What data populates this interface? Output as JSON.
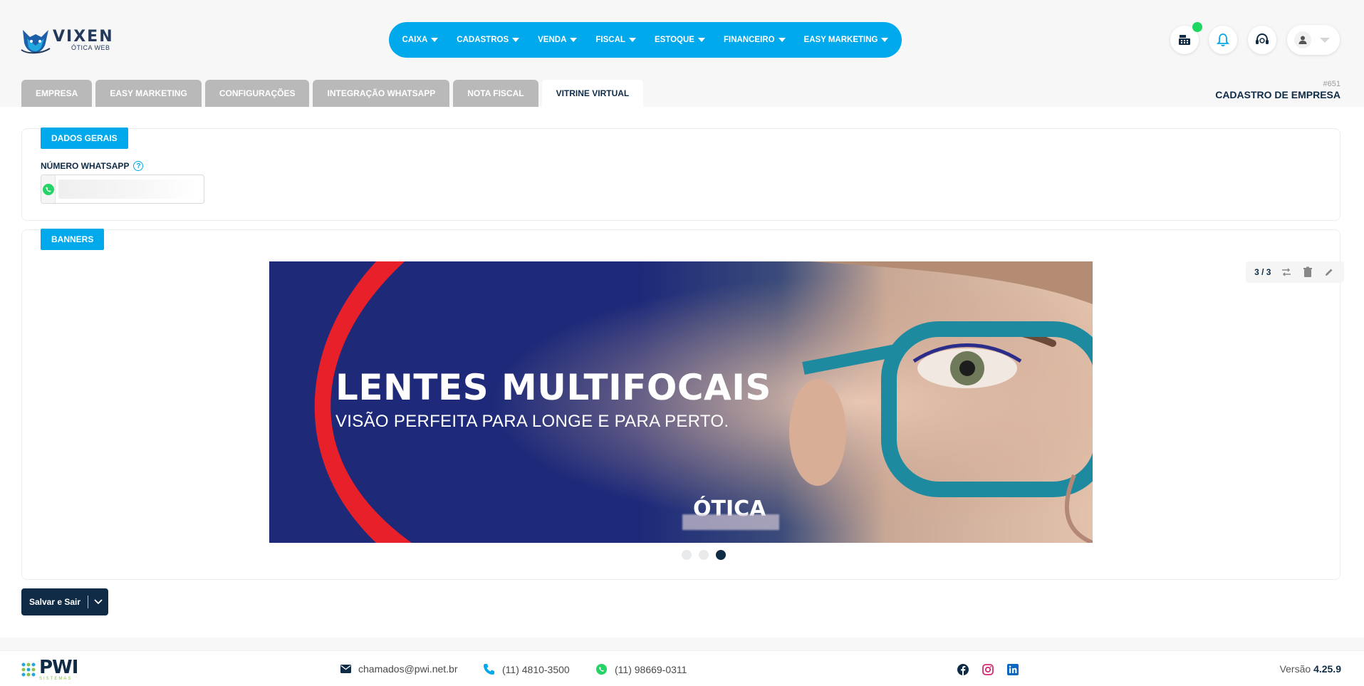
{
  "header": {
    "logo_title": "VIXEN",
    "logo_subtitle": "ÓTICA WEB",
    "nav": [
      {
        "label": "CAIXA"
      },
      {
        "label": "CADASTROS"
      },
      {
        "label": "VENDA"
      },
      {
        "label": "FISCAL"
      },
      {
        "label": "ESTOQUE"
      },
      {
        "label": "FINANCEIRO"
      },
      {
        "label": "EASY MARKETING"
      }
    ],
    "icons": [
      "cash-register-icon",
      "bell-icon",
      "headset-icon",
      "user-icon"
    ]
  },
  "tabs": [
    {
      "label": "EMPRESA",
      "active": false
    },
    {
      "label": "EASY MARKETING",
      "active": false
    },
    {
      "label": "CONFIGURAÇÕES",
      "active": false
    },
    {
      "label": "INTEGRAÇÃO WHATSAPP",
      "active": false
    },
    {
      "label": "NOTA FISCAL",
      "active": false
    },
    {
      "label": "VITRINE VIRTUAL",
      "active": true
    }
  ],
  "page": {
    "id": "#651",
    "title": "CADASTRO DE EMPRESA"
  },
  "dados_gerais": {
    "section_label": "DADOS GERAIS",
    "whatsapp_label": "NÚMERO WHATSAPP",
    "whatsapp_value": "",
    "help": "?"
  },
  "banners": {
    "section_label": "BANNERS",
    "counter": "3 / 3",
    "current": 3,
    "total": 3,
    "banner": {
      "headline": "LENTES MULTIFOCAIS",
      "subheadline": "VISÃO PERFEITA PARA LONGE E PARA PERTO.",
      "brand": "ÓTICA"
    },
    "colors": {
      "navy": "#1e2a78",
      "red": "#e8202a",
      "frame": "#1d8aa0"
    }
  },
  "actions": {
    "save_label": "Salvar e Sair"
  },
  "footer": {
    "logo": "PWI",
    "logo_sub": "SISTEMAS",
    "email": "chamados@pwi.net.br",
    "phone": "(11) 4810-3500",
    "whatsapp": "(11) 98669-0311",
    "version_label": "Versão",
    "version": "4.25.9"
  },
  "colors": {
    "accent": "#00a8ec",
    "primary": "#0f2b45",
    "tab_inactive": "#b9b9b9",
    "online": "#1ed760"
  }
}
